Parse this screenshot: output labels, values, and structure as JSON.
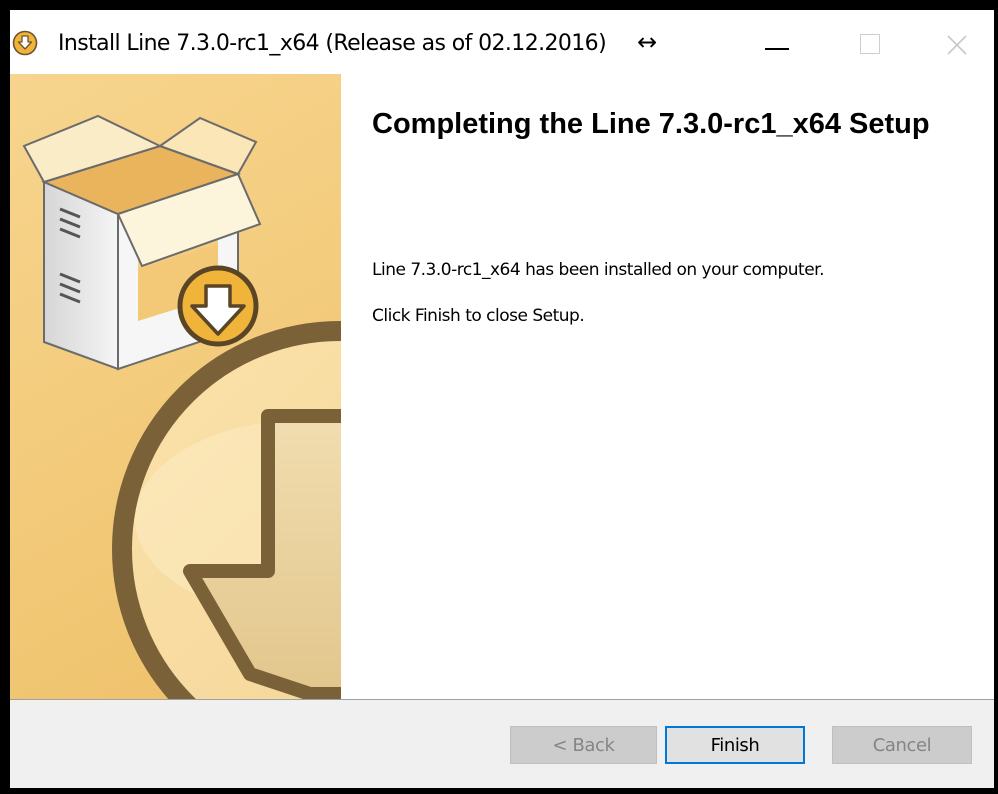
{
  "window": {
    "title": "Install Line 7.3.0-rc1_x64 (Release as of 02.12.2016)",
    "resize_glyph": "↔"
  },
  "page": {
    "heading": "Completing the Line 7.3.0-rc1_x64 Setup",
    "message_installed": "Line 7.3.0-rc1_x64 has been installed on your computer.",
    "message_instruction": "Click Finish to close Setup."
  },
  "buttons": {
    "back": "< Back",
    "finish": "Finish",
    "cancel": "Cancel"
  },
  "colors": {
    "accent": "#0078d7",
    "side_panel": "#f4cf85",
    "button_bar": "#f0f0f0"
  }
}
